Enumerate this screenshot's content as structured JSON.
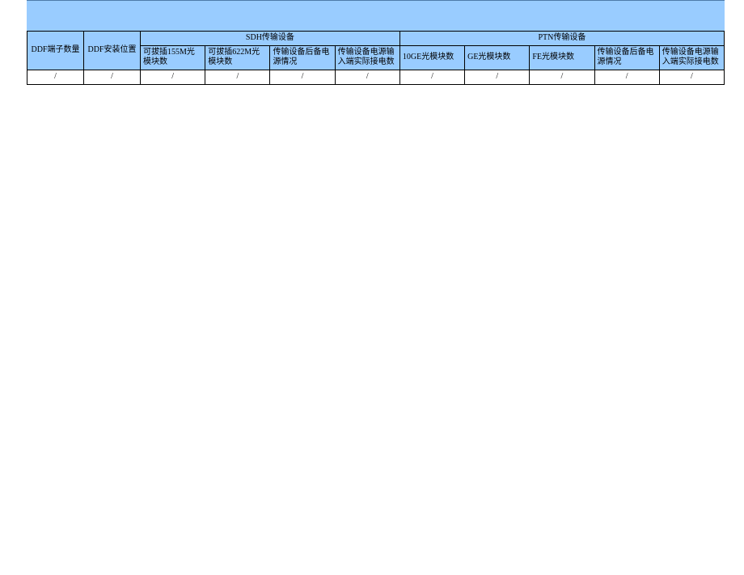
{
  "groupHeaders": {
    "sdh": "SDH传输设备",
    "ptn": "PTN传输设备"
  },
  "headers": {
    "ddf_count": "DDF端子数量",
    "ddf_position": "DDF安装位置",
    "sdh_155m": "可拔插155M光模块数",
    "sdh_622m": "可拔插622M光模块数",
    "sdh_backup_power": "传输设备后备电源情况",
    "sdh_power_input": "传输设备电源输入端实际接电数",
    "ptn_10ge": "10GE光模块数",
    "ptn_ge": "GE光模块数",
    "ptn_fe": "FE光模块数",
    "ptn_backup_power": "传输设备后备电源情况",
    "ptn_power_input": "传输设备电源输入端实际接电数"
  },
  "rows": [
    {
      "ddf_count": "/",
      "ddf_position": "/",
      "sdh_155m": "/",
      "sdh_622m": "/",
      "sdh_backup_power": "/",
      "sdh_power_input": "/",
      "ptn_10ge": "/",
      "ptn_ge": "/",
      "ptn_fe": "/",
      "ptn_backup_power": "/",
      "ptn_power_input": "/"
    }
  ]
}
